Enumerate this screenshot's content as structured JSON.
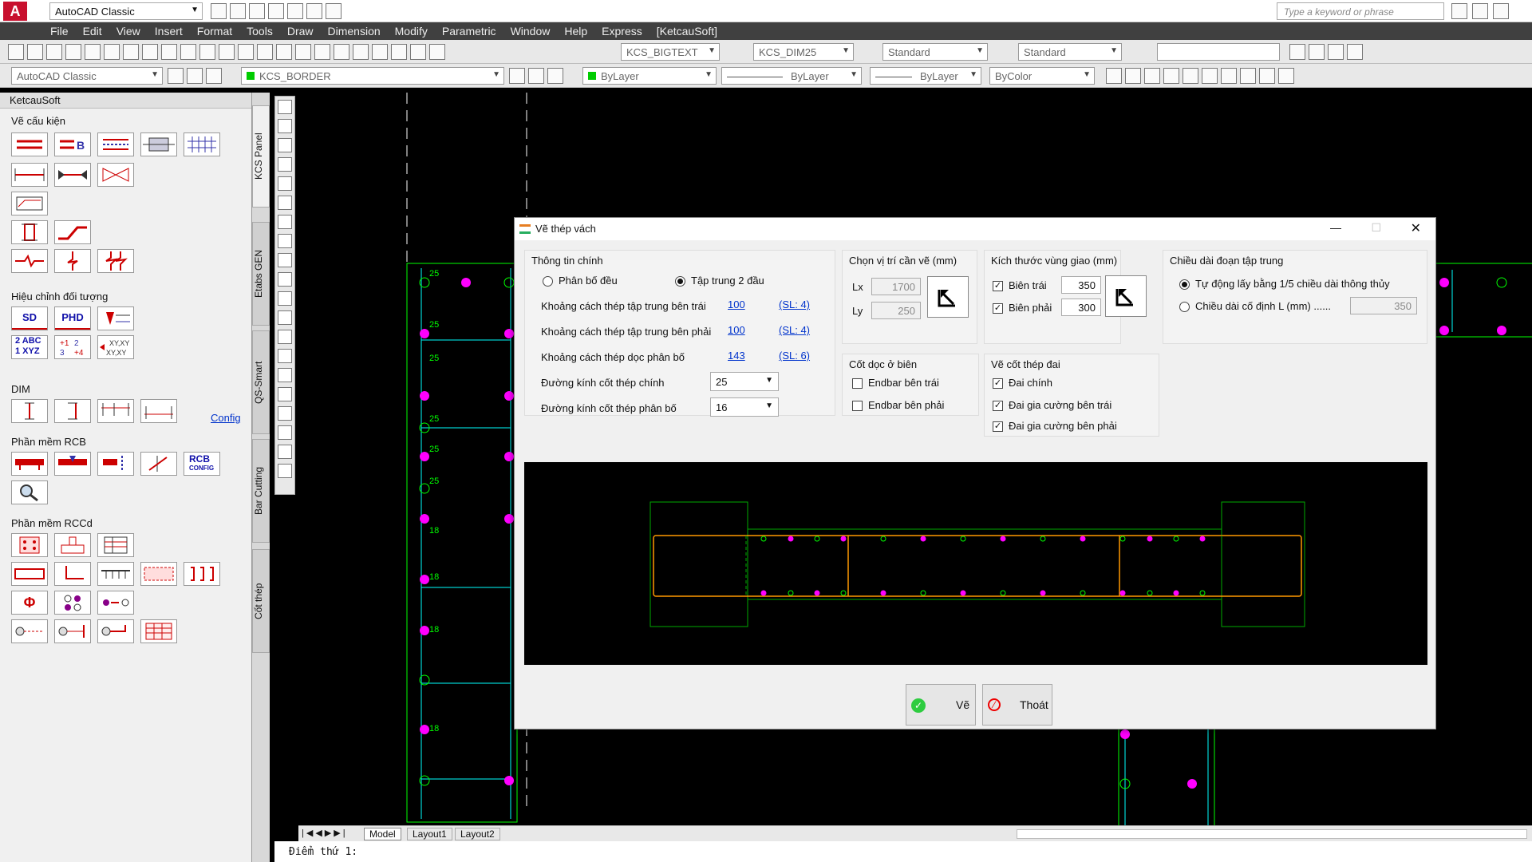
{
  "app": {
    "workspace": "AutoCAD Classic",
    "search_placeholder": "Type a keyword or phrase"
  },
  "menu": [
    "File",
    "Edit",
    "View",
    "Insert",
    "Format",
    "Tools",
    "Draw",
    "Dimension",
    "Modify",
    "Parametric",
    "Window",
    "Help",
    "Express",
    "[KetcauSoft]"
  ],
  "toolbar1": {
    "text_style": "KCS_BIGTEXT",
    "dim_style": "KCS_DIM25",
    "table_style": "Standard",
    "mleader_style": "Standard"
  },
  "toolbar2": {
    "workspace": "AutoCAD Classic",
    "layer": "KCS_BORDER",
    "color": "ByLayer",
    "linetype": "ByLayer",
    "lineweight": "ByLayer",
    "plotstyle": "ByColor"
  },
  "palette": {
    "title": "KetcauSoft",
    "sections": {
      "ve": "Vẽ cấu kiện",
      "hieu": "Hiệu chỉnh đối tượng",
      "dim": "DIM",
      "rcb": "Phần mềm RCB",
      "rccd": "Phần mềm RCCd"
    },
    "config_link": "Config",
    "btn_sd": "SD",
    "btn_phd": "PHD",
    "btn_abc": "2 ABC",
    "btn_xyz": "1 XYZ",
    "btn_rcb": "RCB",
    "btn_rcb_sub": "CONFIG",
    "btn_phi": "Φ"
  },
  "vtabs": [
    "KCS Panel",
    "Etabs GEN",
    "QS-Smart",
    "Bar Cutting",
    "Cốt thép"
  ],
  "layout_tabs": [
    "Model",
    "Layout1",
    "Layout2"
  ],
  "command_line": "Điểm thứ 1:",
  "dialog": {
    "title": "Vẽ thép vách",
    "g1": {
      "title": "Thông tin chính",
      "r1": "Phân bố đều",
      "r2": "Tập trung 2 đầu",
      "row1": {
        "label": "Khoảng cách thép tập trung bên trái",
        "value": "100",
        "sl": "(SL: 4)"
      },
      "row2": {
        "label": "Khoảng cách thép tập trung bên phải",
        "value": "100",
        "sl": "(SL: 4)"
      },
      "row3": {
        "label": "Khoảng cách thép dọc phân bố",
        "value": "143",
        "sl": "(SL: 6)"
      },
      "row4": {
        "label": "Đường kính cốt thép chính",
        "value": "25"
      },
      "row5": {
        "label": "Đường kính cốt thép phân bố",
        "value": "16"
      }
    },
    "g2": {
      "title": "Chọn vị trí cần vẽ (mm)",
      "lx_label": "Lx",
      "lx": "1700",
      "ly_label": "Ly",
      "ly": "250"
    },
    "g3": {
      "title": "Kích thước vùng giao (mm)",
      "c1": "Biên trái",
      "v1": "350",
      "c2": "Biên phải",
      "v2": "300"
    },
    "g4": {
      "title": "Chiều dài đoạn tập trung",
      "r1": "Tự động lấy bằng 1/5 chiều dài thông thủy",
      "r2": "Chiều dài cố định L (mm) ......",
      "v": "350"
    },
    "g5": {
      "title": "Cốt dọc ở biên",
      "c1": "Endbar bên trái",
      "c2": "Endbar bên phải"
    },
    "g6": {
      "title": "Vẽ cốt thép đai",
      "c1": "Đai chính",
      "c2": "Đai gia cường bên trái",
      "c3": "Đai gia cường bên phải"
    },
    "btn_draw": "Vẽ",
    "btn_exit": "Thoát"
  },
  "cad_labels": [
    "25",
    "25",
    "25",
    "25",
    "25",
    "25",
    "18",
    "18",
    "18",
    "18"
  ],
  "colors": {
    "bar": "#ff00ff",
    "stirrup": "#00ffff",
    "outline": "#00ff00",
    "boundary": "#ff9900"
  }
}
